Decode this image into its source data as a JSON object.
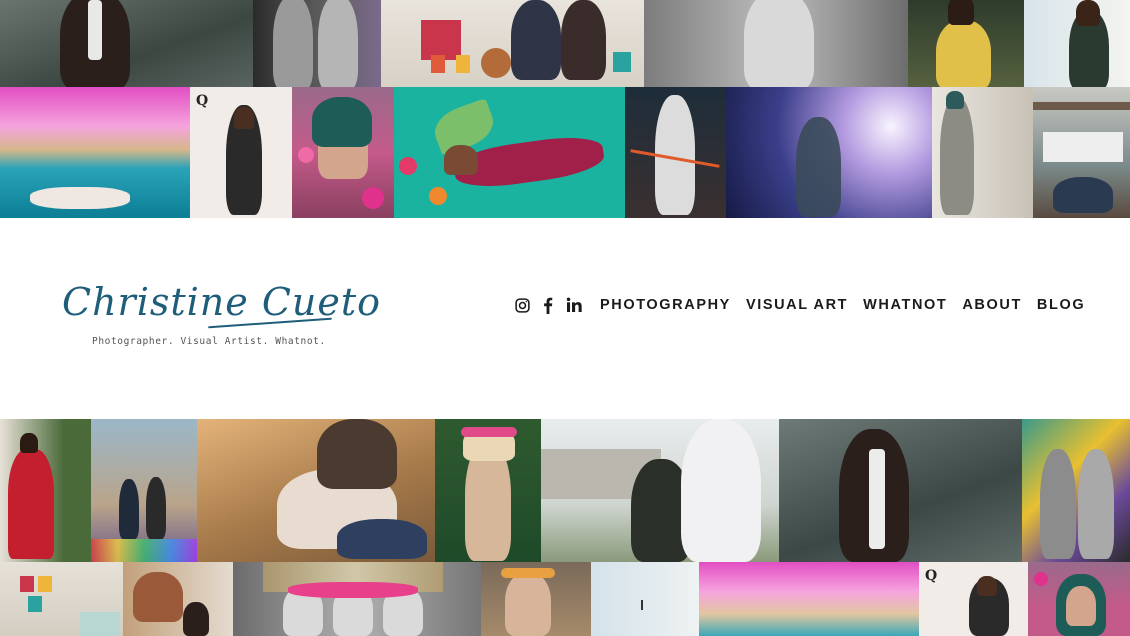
{
  "brand": {
    "name": "Christine Cueto",
    "tagline": "Photographer. Visual Artist. Whatnot."
  },
  "social": [
    {
      "icon": "instagram-icon"
    },
    {
      "icon": "facebook-icon"
    },
    {
      "icon": "linkedin-icon"
    }
  ],
  "nav": {
    "photography": "PHOTOGRAPHY",
    "visual_art": "VISUAL ART",
    "whatnot": "WHATNOT",
    "about": "ABOUT",
    "blog": "BLOG"
  },
  "colors": {
    "brand_blue": "#1f5e7a",
    "nav_text": "#1b1b1b",
    "background": "#ffffff"
  }
}
